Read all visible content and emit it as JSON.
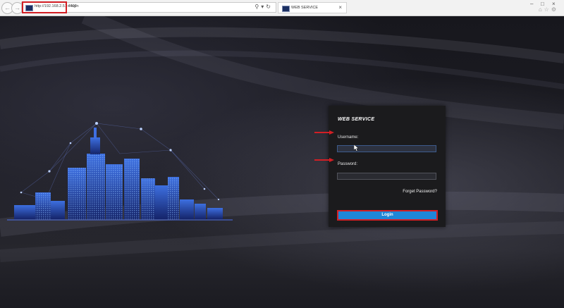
{
  "browser": {
    "url_highlighted": "http://192.168.2.51:4400",
    "url_path": "/ login",
    "tab_title": "WEB SERVICE"
  },
  "login": {
    "title": "WEB SERVICE",
    "username_label": "Username:",
    "username_value": "",
    "password_label": "Password:",
    "password_value": "",
    "forgot_password": "Forget Password?",
    "login_button": "Login"
  },
  "colors": {
    "accent": "#1f86d8",
    "annotation_red": "#d21f25",
    "panel_bg": "#1b1b1d"
  },
  "icons": {
    "back": "back-icon",
    "forward": "forward-icon",
    "search": "search-icon",
    "refresh": "refresh-icon",
    "close": "close-icon"
  }
}
